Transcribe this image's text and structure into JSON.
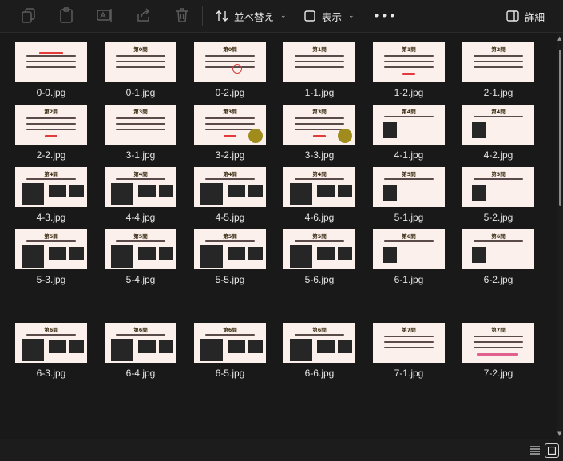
{
  "toolbar": {
    "sort_label": "並べ替え",
    "view_label": "表示",
    "details_label": "詳細",
    "more_label": "•••",
    "icons": [
      "copy-icon",
      "paste-icon",
      "rename-icon",
      "share-icon",
      "delete-icon",
      "sort-icon",
      "view-icon",
      "more-icon",
      "details-pane-icon"
    ]
  },
  "files": [
    {
      "name": "0-0.jpg"
    },
    {
      "name": "0-1.jpg"
    },
    {
      "name": "0-2.jpg"
    },
    {
      "name": "1-1.jpg"
    },
    {
      "name": "1-2.jpg"
    },
    {
      "name": "2-1.jpg"
    },
    {
      "name": "2-2.jpg"
    },
    {
      "name": "3-1.jpg"
    },
    {
      "name": "3-2.jpg"
    },
    {
      "name": "3-3.jpg"
    },
    {
      "name": "4-1.jpg"
    },
    {
      "name": "4-2.jpg"
    },
    {
      "name": "4-3.jpg"
    },
    {
      "name": "4-4.jpg"
    },
    {
      "name": "4-5.jpg"
    },
    {
      "name": "4-6.jpg"
    },
    {
      "name": "5-1.jpg"
    },
    {
      "name": "5-2.jpg"
    },
    {
      "name": "5-3.jpg"
    },
    {
      "name": "5-4.jpg"
    },
    {
      "name": "5-5.jpg"
    },
    {
      "name": "5-6.jpg"
    },
    {
      "name": "6-1.jpg"
    },
    {
      "name": "6-2.jpg"
    },
    {
      "name": "6-3.jpg"
    },
    {
      "name": "6-4.jpg"
    },
    {
      "name": "6-5.jpg"
    },
    {
      "name": "6-6.jpg"
    },
    {
      "name": "7-1.jpg"
    },
    {
      "name": "7-2.jpg"
    }
  ],
  "thumb_titles": {
    "0": "第0問",
    "1": "第1問",
    "2": "第2問",
    "3": "第3問",
    "4": "第4問",
    "5": "第5問",
    "6": "第6問",
    "7": "第7問"
  },
  "colors": {
    "background": "#191919",
    "toolbar": "#1c1c1c",
    "thumb_bg": "#fbf0ec",
    "accent_red": "#e33b3b"
  },
  "view_mode": "large-icons"
}
